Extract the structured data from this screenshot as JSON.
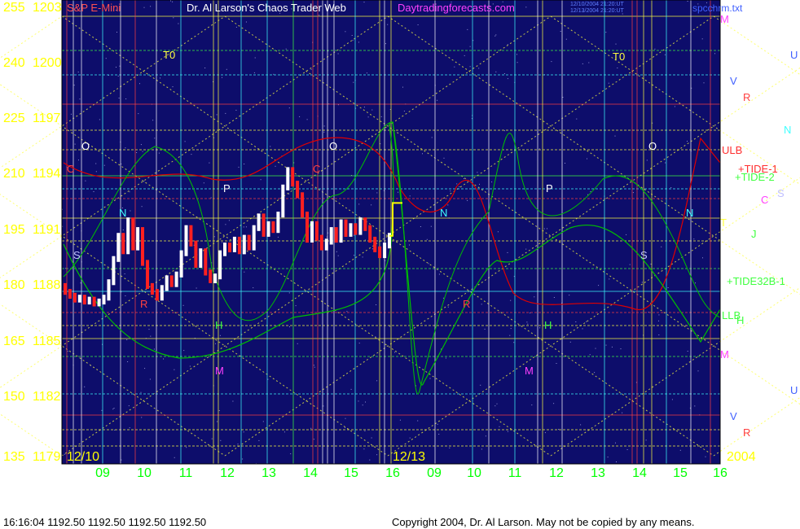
{
  "page": {
    "header_left": "S&P E-Mini",
    "header_center": "Dr. Al Larson's Chaos Trader Web",
    "header_site": "Daytradingforecasts.com",
    "header_right": "spcchrm.txt",
    "stamp_line1": "12/10/2004 21:20:UT",
    "stamp_line2": "12/13/2004 21:20:UT",
    "footer_left": "16:16:04   1192.50  1192.50  1192.50  1192.50",
    "footer_right": "Copyright 2004, Dr. Al Larson. May not be copied by any means."
  },
  "colors": {
    "plot_bg": "#0d0d6b",
    "page_bg": "#ffffff",
    "axis_text": "#ffff00",
    "date_text": "#00ff00",
    "price_up": "#ffffff",
    "price_down": "#ff2020",
    "tide": "#00c000",
    "ulb": "#e00000",
    "grid_yellow": "#ffff40",
    "grid_cyan": "#40ffff",
    "grid_green": "#40ff40",
    "grid_red": "#ff4040"
  },
  "chart_data": {
    "type": "line",
    "y_left_ticks": [
      "255",
      "240",
      "225",
      "210",
      "195",
      "180",
      "165",
      "150",
      "135"
    ],
    "y_price_ticks": [
      "1203",
      "1200",
      "1197",
      "1194",
      "1191",
      "1188",
      "1185",
      "1182",
      "1179"
    ],
    "ylim": [
      1179,
      1203
    ],
    "x_ticks": [
      "09",
      "10",
      "11",
      "12",
      "13",
      "14",
      "15",
      "16",
      "09",
      "10",
      "11",
      "12",
      "13",
      "14",
      "15",
      "16"
    ],
    "date_labels": [
      "12/10",
      "12/13",
      "2004"
    ],
    "series_labels": [
      "ULB",
      "+TIDE-1",
      "+TIDE-2",
      "+TIDE32B-1",
      "LLB"
    ],
    "price_bars": [
      {
        "o": 1188.2,
        "c": 1187.9
      },
      {
        "o": 1187.9,
        "c": 1187.7
      },
      {
        "o": 1187.7,
        "c": 1187.5
      },
      {
        "o": 1187.5,
        "c": 1187.6
      },
      {
        "o": 1187.6,
        "c": 1187.4
      },
      {
        "o": 1187.4,
        "c": 1187.5
      },
      {
        "o": 1187.5,
        "c": 1187.3
      },
      {
        "o": 1187.3,
        "c": 1187.4
      },
      {
        "o": 1187.4,
        "c": 1187.6
      },
      {
        "o": 1187.6,
        "c": 1188.4
      },
      {
        "o": 1188.4,
        "c": 1189.6
      },
      {
        "o": 1189.6,
        "c": 1190.8
      },
      {
        "o": 1190.8,
        "c": 1190.0
      },
      {
        "o": 1190.0,
        "c": 1191.6
      },
      {
        "o": 1191.6,
        "c": 1190.2
      },
      {
        "o": 1190.2,
        "c": 1191.1
      },
      {
        "o": 1191.1,
        "c": 1189.4
      },
      {
        "o": 1189.4,
        "c": 1188.2
      },
      {
        "o": 1188.2,
        "c": 1187.9
      },
      {
        "o": 1187.9,
        "c": 1187.6
      },
      {
        "o": 1187.6,
        "c": 1188.1
      },
      {
        "o": 1188.1,
        "c": 1188.6
      },
      {
        "o": 1188.6,
        "c": 1188.3
      },
      {
        "o": 1188.3,
        "c": 1188.8
      },
      {
        "o": 1188.8,
        "c": 1189.9
      },
      {
        "o": 1189.9,
        "c": 1191.2
      },
      {
        "o": 1191.2,
        "c": 1190.4
      },
      {
        "o": 1190.4,
        "c": 1189.3
      },
      {
        "o": 1189.3,
        "c": 1190.0
      },
      {
        "o": 1190.0,
        "c": 1188.9
      },
      {
        "o": 1188.9,
        "c": 1188.5
      },
      {
        "o": 1188.5,
        "c": 1188.7
      },
      {
        "o": 1188.7,
        "c": 1189.9
      },
      {
        "o": 1189.9,
        "c": 1190.3
      },
      {
        "o": 1190.3,
        "c": 1190.1
      },
      {
        "o": 1190.1,
        "c": 1190.6
      },
      {
        "o": 1190.6,
        "c": 1190.0
      },
      {
        "o": 1190.0,
        "c": 1190.7
      },
      {
        "o": 1190.7,
        "c": 1190.2
      },
      {
        "o": 1190.2,
        "c": 1191.2
      },
      {
        "o": 1191.2,
        "c": 1191.8
      },
      {
        "o": 1191.8,
        "c": 1190.9
      },
      {
        "o": 1190.9,
        "c": 1191.4
      },
      {
        "o": 1191.4,
        "c": 1191.1
      },
      {
        "o": 1191.1,
        "c": 1191.9
      },
      {
        "o": 1191.9,
        "c": 1193.3
      },
      {
        "o": 1193.3,
        "c": 1194.2
      },
      {
        "o": 1194.2,
        "c": 1193.5
      },
      {
        "o": 1193.5,
        "c": 1192.9
      },
      {
        "o": 1192.9,
        "c": 1191.9
      },
      {
        "o": 1191.9,
        "c": 1190.6
      },
      {
        "o": 1190.6,
        "c": 1191.4
      },
      {
        "o": 1191.4,
        "c": 1190.7
      },
      {
        "o": 1190.7,
        "c": 1190.2
      },
      {
        "o": 1190.2,
        "c": 1190.5
      },
      {
        "o": 1190.5,
        "c": 1191.1
      },
      {
        "o": 1191.1,
        "c": 1190.6
      },
      {
        "o": 1190.6,
        "c": 1191.5
      },
      {
        "o": 1191.5,
        "c": 1190.9
      },
      {
        "o": 1190.9,
        "c": 1191.3
      },
      {
        "o": 1191.3,
        "c": 1191.0
      },
      {
        "o": 1191.0,
        "c": 1191.6
      },
      {
        "o": 1191.6,
        "c": 1191.2
      },
      {
        "o": 1191.2,
        "c": 1190.6
      },
      {
        "o": 1190.6,
        "c": 1190.1
      },
      {
        "o": 1190.1,
        "c": 1189.8
      },
      {
        "o": 1189.8,
        "c": 1190.3
      },
      {
        "o": 1190.3,
        "c": 1190.8
      }
    ]
  }
}
